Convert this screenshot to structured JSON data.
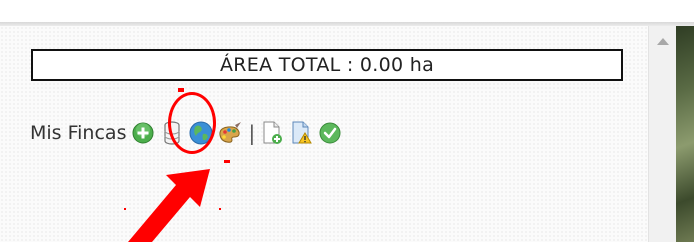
{
  "area": {
    "text": "ÁREA TOTAL : 0.00 ha"
  },
  "toolbar": {
    "label": "Mis Fincas",
    "icons": [
      "add-finca-icon",
      "database-icon",
      "globe-icon",
      "paint-palette-icon",
      "separator",
      "new-document-icon",
      "warning-document-icon",
      "check-icon"
    ],
    "separator": "|"
  },
  "colors": {
    "highlight": "#ff0000",
    "add_green": "#4cae4c",
    "check_green": "#5cb85c"
  }
}
